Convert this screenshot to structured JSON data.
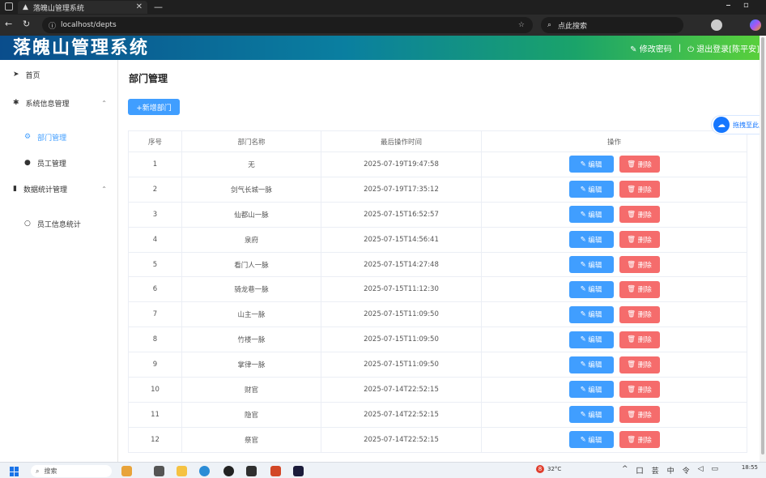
{
  "browser": {
    "tab_title": "落魄山管理系统",
    "url": "localhost/depts",
    "search_placeholder": "点此搜索"
  },
  "app": {
    "title": "落魄山管理系统",
    "change_password": "修改密码",
    "separator": "|",
    "logout": "退出登录[陈平安]"
  },
  "sidebar": {
    "items": [
      {
        "label": "首页",
        "icon": "paper-plane-icon"
      },
      {
        "label": "系统信息管理",
        "icon": "gear-icon"
      },
      {
        "label": "部门管理",
        "icon": "grid-icon"
      },
      {
        "label": "员工管理",
        "icon": "user-icon"
      },
      {
        "label": "数据统计管理",
        "icon": "bar-chart-icon"
      },
      {
        "label": "员工信息统计",
        "icon": "user-outline-icon"
      }
    ]
  },
  "main": {
    "page_title": "部门管理",
    "add_button": "+新增部门",
    "columns": [
      "序号",
      "部门名称",
      "最后操作时间",
      "操作"
    ],
    "edit_label": "编辑",
    "delete_label": "删除",
    "rows": [
      {
        "no": "1",
        "name": "无",
        "time": "2025-07-19T19:47:58"
      },
      {
        "no": "2",
        "name": "剑气长城一脉",
        "time": "2025-07-19T17:35:12"
      },
      {
        "no": "3",
        "name": "仙都山一脉",
        "time": "2025-07-15T16:52:57"
      },
      {
        "no": "4",
        "name": "泉府",
        "time": "2025-07-15T14:56:41"
      },
      {
        "no": "5",
        "name": "看门人一脉",
        "time": "2025-07-15T14:27:48"
      },
      {
        "no": "6",
        "name": "骑龙巷一脉",
        "time": "2025-07-15T11:12:30"
      },
      {
        "no": "7",
        "name": "山主一脉",
        "time": "2025-07-15T11:09:50"
      },
      {
        "no": "8",
        "name": "竹楼一脉",
        "time": "2025-07-15T11:09:50"
      },
      {
        "no": "9",
        "name": "掌律一脉",
        "time": "2025-07-15T11:09:50"
      },
      {
        "no": "10",
        "name": "财官",
        "time": "2025-07-14T22:52:15"
      },
      {
        "no": "11",
        "name": "隐官",
        "time": "2025-07-14T22:52:15"
      },
      {
        "no": "12",
        "name": "祭官",
        "time": "2025-07-14T22:52:15"
      }
    ]
  },
  "floater": {
    "label": "拖拽至此上"
  },
  "taskbar": {
    "search": "搜索",
    "weather_temp": "32°C",
    "weather_badge": "8",
    "tray_glyphs": [
      "^",
      "囗",
      "芸",
      "中",
      "令",
      "◁",
      "▭"
    ],
    "time": "18:55"
  }
}
